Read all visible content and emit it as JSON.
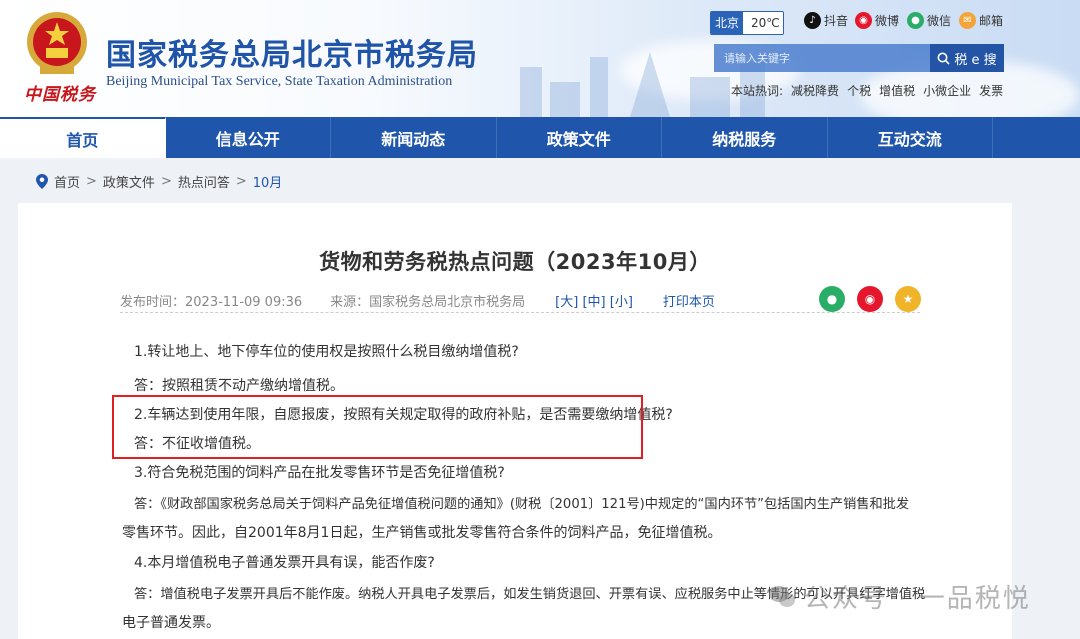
{
  "header": {
    "emblem_text": "中国税务",
    "title": "国家税务总局北京市税务局",
    "subtitle": "Beijing Municipal Tax Service, State Taxation Administration",
    "weather": {
      "city": "北京",
      "temp": "20℃"
    },
    "social": [
      {
        "label": "抖音",
        "icon": "douyin-icon",
        "color": "#111111"
      },
      {
        "label": "微博",
        "icon": "weibo-icon",
        "color": "#e6162d"
      },
      {
        "label": "微信",
        "icon": "wechat-icon",
        "color": "#2aae67"
      },
      {
        "label": "邮箱",
        "icon": "mail-icon",
        "color": "#f3a43a"
      }
    ],
    "search": {
      "placeholder": "请输入关键字",
      "button": "税 e 搜"
    },
    "hotwords": {
      "label": "本站热词:",
      "words": [
        "减税降费",
        "个税",
        "增值税",
        "小微企业",
        "发票"
      ]
    }
  },
  "nav": {
    "items": [
      "首页",
      "信息公开",
      "新闻动态",
      "政策文件",
      "纳税服务",
      "互动交流"
    ],
    "active": 0
  },
  "breadcrumb": {
    "items": [
      "首页",
      "政策文件",
      "热点问答",
      "10月"
    ],
    "separator": ">"
  },
  "article": {
    "title": "货物和劳务税热点问题（2023年10月）",
    "publish": "发布时间：2023-11-09 09:36",
    "source": "来源：国家税务总局北京市税务局",
    "size_large": "[大]",
    "size_mid": "[中]",
    "size_small": "[小]",
    "print": "打印本页",
    "paragraphs": [
      "1.转让地上、地下停车位的使用权是按照什么税目缴纳增值税?",
      "答：按照租赁不动产缴纳增值税。",
      "2.车辆达到使用年限，自愿报废，按照有关规定取得的政府补贴，是否需要缴纳增值税?",
      "答：不征收增值税。",
      "3.符合免税范围的饲料产品在批发零售环节是否免征增值税?",
      "答：《财政部国家税务总局关于饲料产品免征增值税问题的通知》(财税〔2001〕121号)中规定的“国内环节”包括国内生产销售和批发",
      "零售环节。因此，自2001年8月1日起，生产销售或批发零售符合条件的饲料产品，免征增值税。",
      "4.本月增值税电子普通发票开具有误，能否作废?",
      "答：增值税电子发票开具后不能作废。纳税人开具电子发票后，如发生销货退回、开票有误、应税服务中止等情形的可以开具红字增值税",
      "电子普通发票。"
    ]
  },
  "watermark": "公众号 · 一品税悦",
  "colors": {
    "brand_blue": "#1f56ab",
    "highlight_red": "#e02020"
  }
}
